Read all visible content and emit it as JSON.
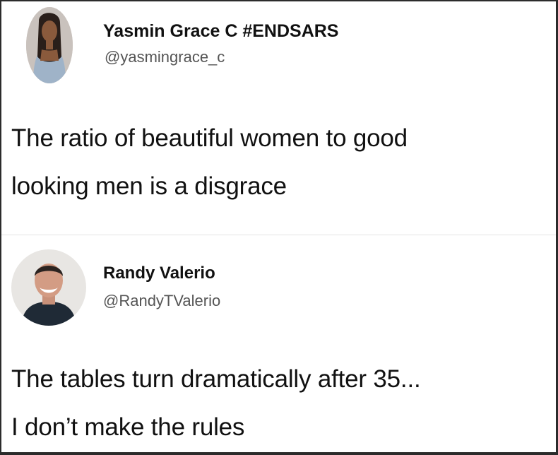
{
  "tweets": [
    {
      "display_name": "Yasmin Grace C #ENDSARS",
      "handle": "@yasmingrace_c",
      "avatar_icon": "woman-profile-photo-icon",
      "text_lines": [
        "The ratio of beautiful women to good",
        "looking men is a disgrace"
      ]
    },
    {
      "display_name": "Randy Valerio",
      "handle": "@RandyTValerio",
      "avatar_icon": "man-profile-photo-icon",
      "text_lines": [
        "The tables turn dramatically after 35...",
        "I don’t make the rules"
      ]
    }
  ],
  "colors": {
    "background": "#ffffff",
    "text": "#111111",
    "handle": "#555555",
    "divider": "#e3e3e3",
    "frame": "#2b2b2b"
  }
}
